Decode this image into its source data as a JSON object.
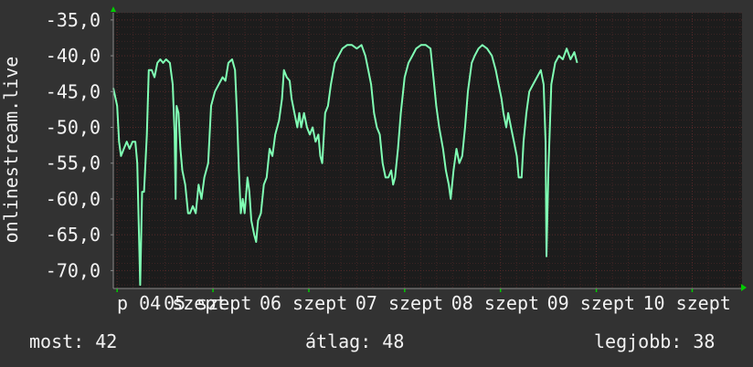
{
  "chart_data": {
    "type": "line",
    "ylabel": "onlinestream.live",
    "ylim": [
      -72.5,
      -34
    ],
    "y_ticks": [
      "-35,0",
      "-40,0",
      "-45,0",
      "-50,0",
      "-55,0",
      "-60,0",
      "-65,0",
      "-70,0"
    ],
    "y_tick_values": [
      -35,
      -40,
      -45,
      -50,
      -55,
      -60,
      -65,
      -70
    ],
    "x_tick_labels": [
      "p 04 szept",
      "05 szept",
      "06 szept",
      "07 szept",
      "08 szept",
      "09 szept",
      "10 szept"
    ],
    "x_tick_positions": [
      0.0,
      1.0,
      2.0,
      3.0,
      4.0,
      5.0,
      6.0
    ],
    "xlim": [
      -0.04,
      6.52
    ],
    "grid": true,
    "colors": {
      "line": "#80ffb4",
      "background": "#323232",
      "plot": "#1c1c1c",
      "grid": "#5a2a2a",
      "axis_arrow": "#00cc00"
    },
    "series": [
      {
        "values": [
          [
            -0.04,
            -44.5
          ],
          [
            0.0,
            -47
          ],
          [
            0.02,
            -52
          ],
          [
            0.04,
            -54
          ],
          [
            0.07,
            -53
          ],
          [
            0.1,
            -52
          ],
          [
            0.13,
            -53
          ],
          [
            0.16,
            -52
          ],
          [
            0.19,
            -52
          ],
          [
            0.21,
            -55
          ],
          [
            0.24,
            -72
          ],
          [
            0.26,
            -59
          ],
          [
            0.28,
            -59
          ],
          [
            0.31,
            -51
          ],
          [
            0.33,
            -42
          ],
          [
            0.36,
            -42
          ],
          [
            0.39,
            -43
          ],
          [
            0.42,
            -41
          ],
          [
            0.45,
            -40.5
          ],
          [
            0.48,
            -41
          ],
          [
            0.51,
            -40.5
          ],
          [
            0.55,
            -41
          ],
          [
            0.58,
            -44
          ],
          [
            0.6,
            -51
          ],
          [
            0.61,
            -60
          ],
          [
            0.62,
            -47
          ],
          [
            0.64,
            -48
          ],
          [
            0.66,
            -53
          ],
          [
            0.68,
            -56
          ],
          [
            0.71,
            -58
          ],
          [
            0.74,
            -62
          ],
          [
            0.76,
            -62
          ],
          [
            0.79,
            -61
          ],
          [
            0.82,
            -62
          ],
          [
            0.85,
            -58
          ],
          [
            0.88,
            -60
          ],
          [
            0.91,
            -57
          ],
          [
            0.95,
            -55
          ],
          [
            0.98,
            -47
          ],
          [
            1.02,
            -45
          ],
          [
            1.06,
            -44
          ],
          [
            1.1,
            -43
          ],
          [
            1.13,
            -43.5
          ],
          [
            1.16,
            -41
          ],
          [
            1.2,
            -40.5
          ],
          [
            1.23,
            -42
          ],
          [
            1.25,
            -48
          ],
          [
            1.27,
            -56
          ],
          [
            1.29,
            -62
          ],
          [
            1.31,
            -60
          ],
          [
            1.33,
            -62
          ],
          [
            1.36,
            -57
          ],
          [
            1.38,
            -59
          ],
          [
            1.4,
            -63
          ],
          [
            1.43,
            -65
          ],
          [
            1.45,
            -66
          ],
          [
            1.47,
            -63
          ],
          [
            1.5,
            -62
          ],
          [
            1.53,
            -58
          ],
          [
            1.56,
            -57
          ],
          [
            1.59,
            -53
          ],
          [
            1.62,
            -54
          ],
          [
            1.65,
            -51
          ],
          [
            1.69,
            -49
          ],
          [
            1.72,
            -46
          ],
          [
            1.74,
            -42
          ],
          [
            1.77,
            -43
          ],
          [
            1.8,
            -43.5
          ],
          [
            1.82,
            -46
          ],
          [
            1.85,
            -48
          ],
          [
            1.88,
            -50
          ],
          [
            1.9,
            -48
          ],
          [
            1.92,
            -50
          ],
          [
            1.95,
            -48
          ],
          [
            1.98,
            -50
          ],
          [
            2.01,
            -51
          ],
          [
            2.04,
            -50
          ],
          [
            2.07,
            -52
          ],
          [
            2.1,
            -51
          ],
          [
            2.12,
            -54
          ],
          [
            2.14,
            -55
          ],
          [
            2.17,
            -48
          ],
          [
            2.2,
            -47
          ],
          [
            2.23,
            -44
          ],
          [
            2.27,
            -41
          ],
          [
            2.31,
            -40
          ],
          [
            2.35,
            -39
          ],
          [
            2.4,
            -38.5
          ],
          [
            2.45,
            -38.5
          ],
          [
            2.5,
            -39
          ],
          [
            2.55,
            -38.5
          ],
          [
            2.59,
            -40
          ],
          [
            2.62,
            -42
          ],
          [
            2.65,
            -44
          ],
          [
            2.68,
            -48
          ],
          [
            2.71,
            -50
          ],
          [
            2.74,
            -51
          ],
          [
            2.77,
            -55
          ],
          [
            2.8,
            -57
          ],
          [
            2.83,
            -57
          ],
          [
            2.86,
            -56
          ],
          [
            2.88,
            -58
          ],
          [
            2.9,
            -57
          ],
          [
            2.93,
            -53
          ],
          [
            2.96,
            -48
          ],
          [
            3.0,
            -43
          ],
          [
            3.04,
            -41
          ],
          [
            3.08,
            -40
          ],
          [
            3.12,
            -39
          ],
          [
            3.17,
            -38.5
          ],
          [
            3.22,
            -38.5
          ],
          [
            3.27,
            -39
          ],
          [
            3.3,
            -43
          ],
          [
            3.33,
            -47
          ],
          [
            3.36,
            -50
          ],
          [
            3.4,
            -53
          ],
          [
            3.43,
            -56
          ],
          [
            3.46,
            -58
          ],
          [
            3.48,
            -60
          ],
          [
            3.51,
            -56
          ],
          [
            3.54,
            -53
          ],
          [
            3.57,
            -55
          ],
          [
            3.6,
            -54
          ],
          [
            3.63,
            -50
          ],
          [
            3.66,
            -45
          ],
          [
            3.7,
            -41
          ],
          [
            3.73,
            -40
          ],
          [
            3.77,
            -39
          ],
          [
            3.81,
            -38.5
          ],
          [
            3.86,
            -39
          ],
          [
            3.91,
            -40
          ],
          [
            3.95,
            -42
          ],
          [
            3.98,
            -44
          ],
          [
            4.01,
            -46
          ],
          [
            4.03,
            -48
          ],
          [
            4.06,
            -50
          ],
          [
            4.08,
            -48
          ],
          [
            4.11,
            -50
          ],
          [
            4.14,
            -52
          ],
          [
            4.17,
            -54
          ],
          [
            4.19,
            -57
          ],
          [
            4.22,
            -57
          ],
          [
            4.24,
            -52
          ],
          [
            4.27,
            -48
          ],
          [
            4.3,
            -45
          ],
          [
            4.34,
            -44
          ],
          [
            4.38,
            -43
          ],
          [
            4.42,
            -42
          ],
          [
            4.45,
            -44
          ],
          [
            4.47,
            -52
          ],
          [
            4.48,
            -68
          ],
          [
            4.5,
            -56
          ],
          [
            4.53,
            -44
          ],
          [
            4.57,
            -41
          ],
          [
            4.61,
            -40
          ],
          [
            4.65,
            -40.5
          ],
          [
            4.69,
            -39
          ],
          [
            4.73,
            -40.5
          ],
          [
            4.77,
            -39.5
          ],
          [
            4.8,
            -41
          ]
        ]
      }
    ]
  },
  "stats": {
    "now": "most: 42",
    "avg": "átlag: 48",
    "best": "legjobb: 38"
  }
}
